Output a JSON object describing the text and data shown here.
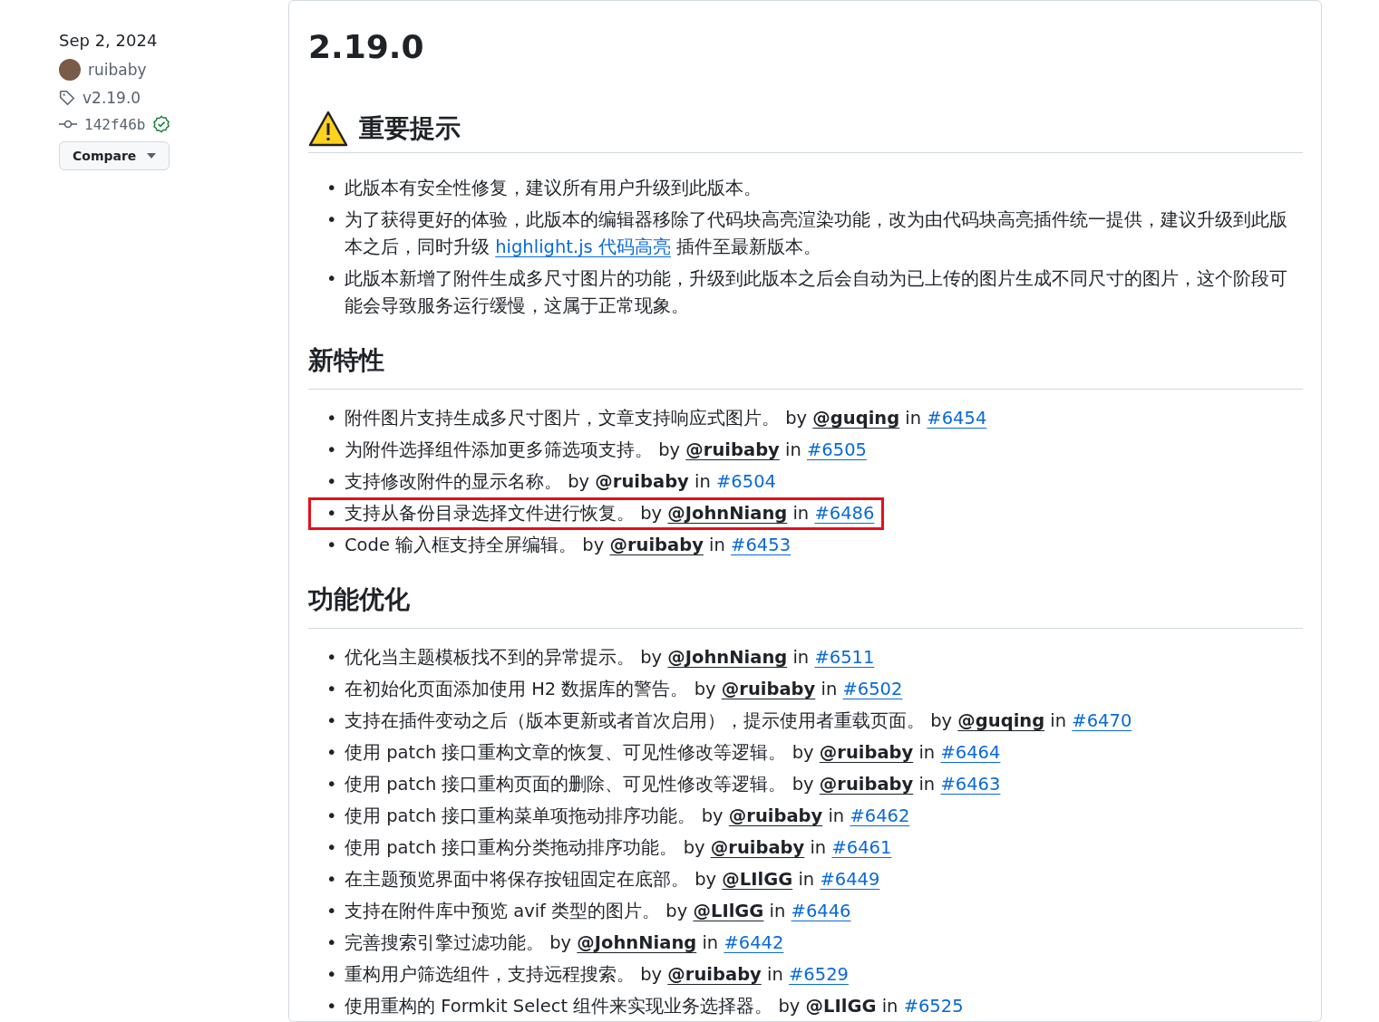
{
  "sidebar": {
    "date": "Sep 2, 2024",
    "author": "ruibaby",
    "tag": "v2.19.0",
    "commit": "142f46b",
    "verified": true,
    "compare_button": "Compare"
  },
  "release": {
    "title": "2.19.0",
    "notice": {
      "heading": "重要提示",
      "items": [
        {
          "bullet": "•",
          "text": "此版本有安全性修复，建议所有用户升级到此版本。"
        },
        {
          "bullet": "•",
          "text": "为了获得更好的体验，此版本的编辑器移除了代码块高亮渲染功能，改为由代码块高亮插件统一提供，建议升级到此版本之后，同时升级 ",
          "link": "highlight.js 代码高亮",
          "after": " 插件至最新版本。"
        },
        {
          "bullet": "•",
          "text": "此版本新增了附件生成多尺寸图片的功能，升级到此版本之后会自动为已上传的图片生成不同尺寸的图片，这个阶段可能会导致服务运行缓慢，这属于正常现象。"
        }
      ]
    },
    "sections": [
      {
        "heading": "新特性",
        "items": [
          {
            "bullet": "•",
            "text": "附件图片支持生成多尺寸图片，文章支持响应式图片。",
            "by": "by",
            "author": "@guqing",
            "in": "in",
            "pr": "#6454",
            "underlined": true,
            "highlighted": false
          },
          {
            "bullet": "•",
            "text": "为附件选择组件添加更多筛选项支持。",
            "by": "by",
            "author": "@ruibaby",
            "in": "in",
            "pr": "#6505",
            "underlined": true,
            "highlighted": false
          },
          {
            "bullet": "•",
            "text": "支持修改附件的显示名称。",
            "by": "by",
            "author": "@ruibaby",
            "in": "in",
            "pr": "#6504",
            "underlined": false,
            "highlighted": false
          },
          {
            "bullet": "•",
            "text": "支持从备份目录选择文件进行恢复。",
            "by": "by",
            "author": "@JohnNiang",
            "in": "in",
            "pr": "#6486",
            "underlined": true,
            "highlighted": true
          },
          {
            "bullet": "•",
            "text": "Code 输入框支持全屏编辑。",
            "by": "by",
            "author": "@ruibaby",
            "in": "in",
            "pr": "#6453",
            "underlined": true,
            "highlighted": false
          }
        ]
      },
      {
        "heading": "功能优化",
        "items": [
          {
            "bullet": "•",
            "text": "优化当主题模板找不到的异常提示。",
            "by": "by",
            "author": "@JohnNiang",
            "in": "in",
            "pr": "#6511",
            "underlined": true,
            "highlighted": false
          },
          {
            "bullet": "•",
            "text": "在初始化页面添加使用 H2 数据库的警告。",
            "by": "by",
            "author": "@ruibaby",
            "in": "in",
            "pr": "#6502",
            "underlined": true,
            "highlighted": false
          },
          {
            "bullet": "•",
            "text": "支持在插件变动之后（版本更新或者首次启用），提示使用者重载页面。",
            "by": "by",
            "author": "@guqing",
            "in": "in",
            "pr": "#6470",
            "underlined": true,
            "highlighted": false
          },
          {
            "bullet": "•",
            "text": "使用 patch 接口重构文章的恢复、可见性修改等逻辑。",
            "by": "by",
            "author": "@ruibaby",
            "in": "in",
            "pr": "#6464",
            "underlined": true,
            "highlighted": false
          },
          {
            "bullet": "•",
            "text": "使用 patch 接口重构页面的删除、可见性修改等逻辑。",
            "by": "by",
            "author": "@ruibaby",
            "in": "in",
            "pr": "#6463",
            "underlined": true,
            "highlighted": false
          },
          {
            "bullet": "•",
            "text": "使用 patch 接口重构菜单项拖动排序功能。",
            "by": "by",
            "author": "@ruibaby",
            "in": "in",
            "pr": "#6462",
            "underlined": true,
            "highlighted": false
          },
          {
            "bullet": "•",
            "text": "使用 patch 接口重构分类拖动排序功能。",
            "by": "by",
            "author": "@ruibaby",
            "in": "in",
            "pr": "#6461",
            "underlined": true,
            "highlighted": false
          },
          {
            "bullet": "•",
            "text": "在主题预览界面中将保存按钮固定在底部。",
            "by": "by",
            "author": "@LIlGG",
            "in": "in",
            "pr": "#6449",
            "underlined": true,
            "highlighted": false
          },
          {
            "bullet": "•",
            "text": "支持在附件库中预览 avif 类型的图片。",
            "by": "by",
            "author": "@LIlGG",
            "in": "in",
            "pr": "#6446",
            "underlined": true,
            "highlighted": false
          },
          {
            "bullet": "•",
            "text": "完善搜索引擎过滤功能。",
            "by": "by",
            "author": "@JohnNiang",
            "in": "in",
            "pr": "#6442",
            "underlined": true,
            "highlighted": false
          },
          {
            "bullet": "•",
            "text": "重构用户筛选组件，支持远程搜索。",
            "by": "by",
            "author": "@ruibaby",
            "in": "in",
            "pr": "#6529",
            "underlined": true,
            "highlighted": false
          },
          {
            "bullet": "•",
            "text": "使用重构的 Formkit Select 组件来实现业务选择器。",
            "by": "by",
            "author": "@LIlGG",
            "in": "in",
            "pr": "#6525",
            "underlined": false,
            "highlighted": false
          }
        ]
      }
    ]
  }
}
